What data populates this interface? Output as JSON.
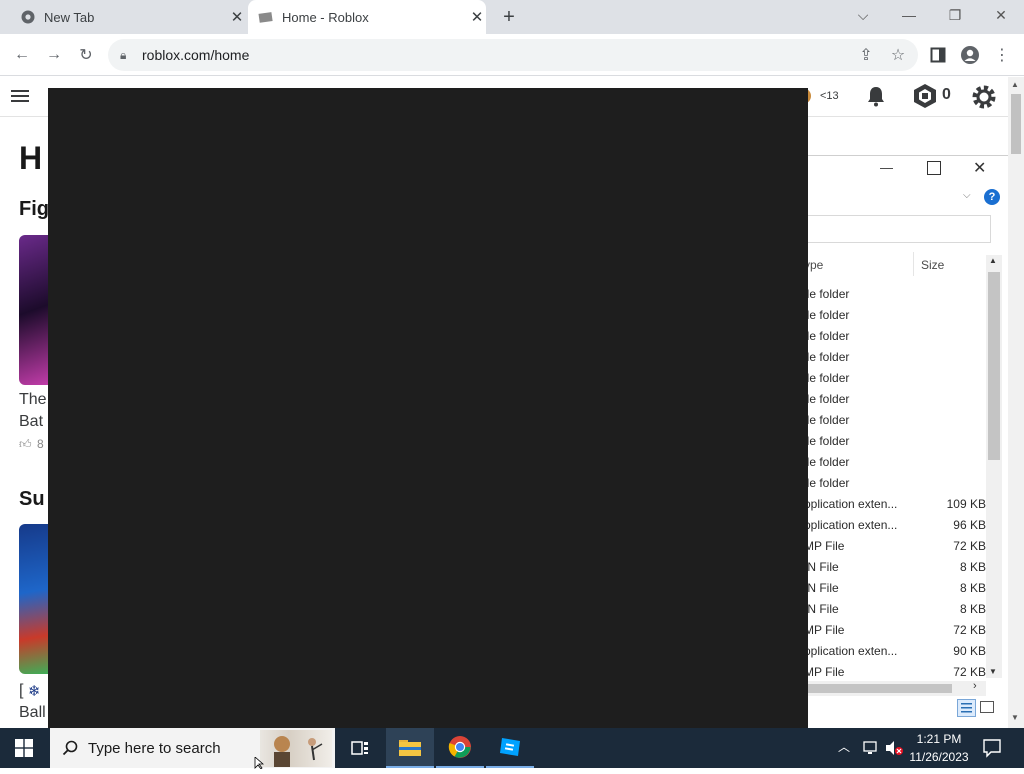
{
  "browser": {
    "tabs": [
      {
        "label": "New Tab"
      },
      {
        "label": "Home - Roblox"
      }
    ],
    "url": "roblox.com/home"
  },
  "roblox": {
    "page_title_fragment": "H",
    "section1_fragment": "Fig",
    "game1_fragment_line1": "The",
    "game1_fragment_line2": "Bat",
    "game1_rating_fragment": "8",
    "section2_fragment": "Su",
    "game2_fragment_line1": "[",
    "game2_fragment_line2": "Ball",
    "age_badge": "<13",
    "robux_count": "0"
  },
  "explorer": {
    "columns": {
      "type": "ype",
      "size": "Size"
    },
    "rows": [
      {
        "type": "ile folder",
        "size": ""
      },
      {
        "type": "ile folder",
        "size": ""
      },
      {
        "type": "ile folder",
        "size": ""
      },
      {
        "type": "ile folder",
        "size": ""
      },
      {
        "type": "ile folder",
        "size": ""
      },
      {
        "type": "ile folder",
        "size": ""
      },
      {
        "type": "ile folder",
        "size": ""
      },
      {
        "type": "ile folder",
        "size": ""
      },
      {
        "type": "ile folder",
        "size": ""
      },
      {
        "type": "ile folder",
        "size": ""
      },
      {
        "type": "pplication exten...",
        "size": "109 KB"
      },
      {
        "type": "pplication exten...",
        "size": "96 KB"
      },
      {
        "type": "MP File",
        "size": "72 KB"
      },
      {
        "type": "IN File",
        "size": "8 KB"
      },
      {
        "type": "IN File",
        "size": "8 KB"
      },
      {
        "type": "IN File",
        "size": "8 KB"
      },
      {
        "type": "MP File",
        "size": "72 KB"
      },
      {
        "type": "pplication exten...",
        "size": "90 KB"
      },
      {
        "type": "MP File",
        "size": "72 KB"
      }
    ]
  },
  "taskbar": {
    "search_placeholder": "Type here to search",
    "time": "1:21 PM",
    "date": "11/26/2023"
  }
}
